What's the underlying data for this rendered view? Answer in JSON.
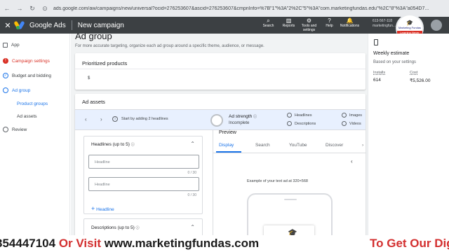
{
  "browser": {
    "url": "ads.google.com/aw/campaigns/new/universal?ocid=276253607&ascid=276253607&cmpnInfo=%7B\"1\"%3A\"2%2C\"5\"%3A\"com.marketingfundas.edu\"%2C\"8\"%3A\"a054D7..."
  },
  "header": {
    "close": "✕",
    "brand": "Google Ads",
    "campaign": "New campaign",
    "tools": [
      {
        "icon": "⌕",
        "label": "Search"
      },
      {
        "icon": "▥",
        "label": "Reports"
      },
      {
        "icon": "⚙",
        "label": "Tools and settings"
      },
      {
        "icon": "?",
        "label": "Help"
      },
      {
        "icon": "🔔",
        "label": "Notifications"
      }
    ],
    "account_id": "613-567-118",
    "account_name": "marketingfun..."
  },
  "watermark": {
    "line1": "Marketing",
    "line2": "Fundas",
    "ribbon": "Learning Never Ends"
  },
  "sidebar": {
    "items": [
      {
        "label": "App",
        "status": "done"
      },
      {
        "label": "Campaign settings",
        "status": "error"
      },
      {
        "label": "Budget and bidding",
        "status": "check"
      },
      {
        "label": "Ad group",
        "status": "current"
      },
      {
        "label": "Review",
        "status": "pending"
      }
    ],
    "sub_items": [
      "Product groups",
      "Ad assets"
    ]
  },
  "main": {
    "title": "Ad group",
    "description": "For more accurate targeting, organize each ad group around a specific theme, audience, or message.",
    "prioritized_title": "Prioritized products",
    "prioritized_value": "$",
    "assets_title": "Ad assets",
    "strip": {
      "start_text": "Start by adding 2 headlines",
      "ad_strength_label": "Ad strength",
      "ad_strength_value": "Incomplete",
      "checks": [
        "Headlines",
        "Descriptions",
        "Images",
        "Videos"
      ]
    },
    "headlines": {
      "title": "Headlines (up to 5)",
      "fields": [
        {
          "placeholder": "Headline",
          "count": "0 / 30"
        },
        {
          "placeholder": "Headline",
          "count": "0 / 30"
        }
      ],
      "add_label": "Headline"
    },
    "descriptions": {
      "title": "Descriptions (up to 5)"
    },
    "preview": {
      "title": "Preview",
      "tabs": [
        "Display",
        "Search",
        "YouTube",
        "Discover"
      ],
      "active_tab": "Display",
      "example": "Example of your text ad at 320×568"
    }
  },
  "estimate": {
    "title": "Weekly estimate",
    "subtitle": "Based on your settings",
    "installs_label": "Installs",
    "installs_value": "614",
    "cost_label": "Cost",
    "cost_value": "₹5,526.00"
  },
  "banner": {
    "phone": "354447104",
    "or_visit": "Or Visit",
    "site": "www.marketingfundas.com",
    "cta": "To Get Our Dig"
  },
  "colors": {
    "accent": "#1a73e8",
    "header_bg": "#3c4043",
    "error": "#d93025",
    "banner_red": "#d32f2f"
  }
}
